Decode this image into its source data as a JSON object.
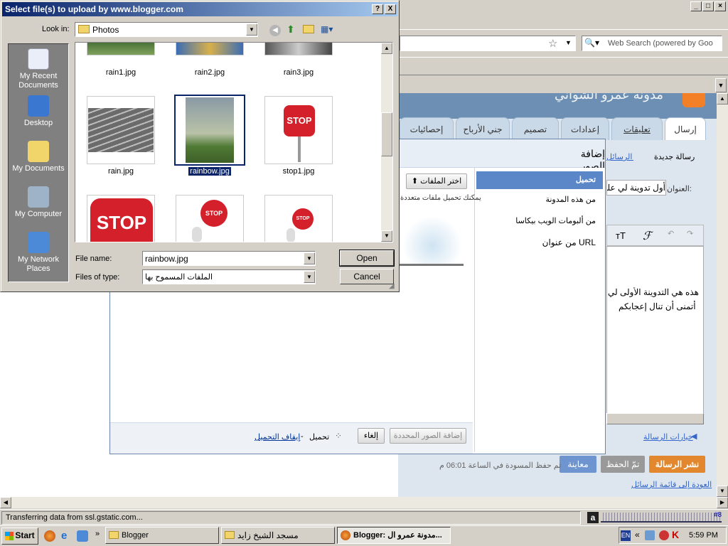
{
  "dialog": {
    "title": "Select file(s) to upload by www.blogger.com",
    "help_btn": "?",
    "close_btn": "X",
    "look_in_label": "Look in:",
    "look_in_value": "Photos",
    "places": [
      "My Recent Documents",
      "Desktop",
      "My Documents",
      "My Computer",
      "My Network Places"
    ],
    "files": [
      "rain1.jpg",
      "rain2.jpg",
      "rain3.jpg",
      "rain.jpg",
      "rainbow.jpg",
      "stop1.jpg"
    ],
    "file_name_label": "File name:",
    "file_name_value": "rainbow.jpg",
    "file_type_label": "Files of type:",
    "file_type_value": "الملفات المسموح بها",
    "open_btn": "Open",
    "cancel_btn": "Cancel",
    "stop_text": "STOP"
  },
  "browser": {
    "search_placeholder": "Web Search (powered by Goo",
    "status": "Transferring data from ssl.gstatic.com...",
    "tab_count": "#8",
    "zoom_btn": "◂"
  },
  "blogger": {
    "blog_title": "مدونة عمرو الشواني",
    "tabs": [
      "إرسال",
      "تعليقات",
      "إعدادات",
      "تصميم",
      "جني الأرباح",
      "إحصائيات"
    ],
    "subtabs": [
      "رسالة جديدة",
      "تحرير الرسائل"
    ],
    "title_label": "العنوان:",
    "title_value": "أول تدوينة لي على",
    "post_line1": "هذه هي التدوينة الأولى لي",
    "post_line2": "أتمنى أن تنال إعجابكم",
    "post_options": "خيارات الرسالة",
    "publish_btn": "نشر الرسالة",
    "saved_btn": "تمّ الحفظ",
    "preview_btn": "معاينة",
    "draft_status": "تم حفظ المسودة في الساعة 06:01 م",
    "back_link": "العودة إلى قائمة الرسائل"
  },
  "modal": {
    "title": "إضافة الصور",
    "menu": [
      "تحميل",
      "من هذه المدونة",
      "من ألبومات الويب بيكاسا",
      "من عنوان URL"
    ],
    "choose_btn": "اختر الملفات",
    "hint": "يمكنك تحميل ملفات متعددة",
    "cancel_btn": "إلغاء",
    "add_btn": "إضافة الصور المحددة",
    "uploading": "تحميل",
    "stop_upload": "إيقاف التحميل"
  },
  "taskbar": {
    "start": "Start",
    "items": [
      "Blogger",
      "مسجد الشيخ زايد",
      "Blogger: مدونة عمرو ال..."
    ],
    "lang": "EN",
    "time": "5:59 PM"
  }
}
